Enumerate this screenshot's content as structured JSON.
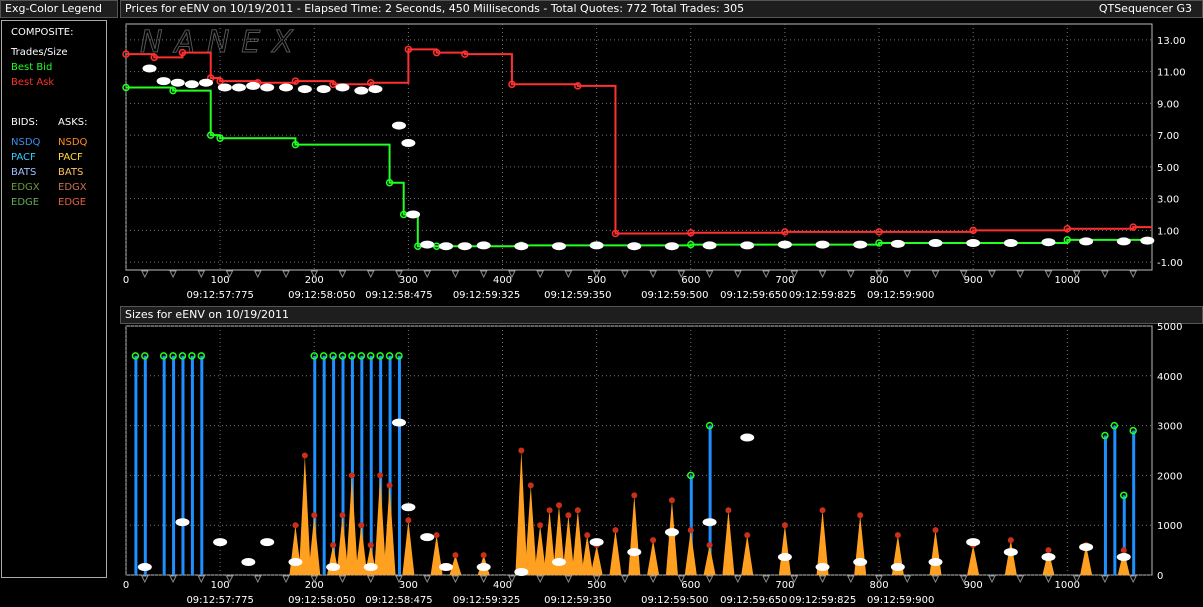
{
  "legend": {
    "title": "Exg-Color Legend",
    "composite_label": "COMPOSITE:",
    "trades_label": "Trades/Size",
    "best_bid_label": "Best Bid",
    "best_ask_label": "Best Ask",
    "bids_label": "BIDS:",
    "asks_label": "ASKS:",
    "exchanges": [
      {
        "bid": "NSDQ",
        "ask": "NSDQ",
        "bid_color": "#3b8eea",
        "ask_color": "#ff8c1a"
      },
      {
        "bid": "PACF",
        "ask": "PACF",
        "bid_color": "#33ccff",
        "ask_color": "#ffdd33"
      },
      {
        "bid": "BATS",
        "ask": "BATS",
        "bid_color": "#a0c0ff",
        "ask_color": "#ffc060"
      },
      {
        "bid": "EDGX",
        "ask": "EDGX",
        "bid_color": "#6a9a3a",
        "ask_color": "#c87050"
      },
      {
        "bid": "EDGE",
        "ask": "EDGE",
        "bid_color": "#66aa55",
        "ask_color": "#e06040"
      }
    ],
    "colors": {
      "trades": "#ffffff",
      "best_bid": "#22ff22",
      "best_ask": "#ff3030"
    }
  },
  "price_header": {
    "text": "Prices for  eENV  on  10/19/2011   -  Elapsed Time: 2 Seconds, 450 Milliseconds   -  Total Quotes: 772   Total Trades: 305",
    "app_title": "QTSequencer G3"
  },
  "sizes_header": {
    "text": "Sizes for  eENV  on  10/19/2011"
  },
  "watermark": "NANEX",
  "x_axis": {
    "ticks": [
      "0",
      "100",
      "200",
      "300",
      "400",
      "500",
      "600",
      "700",
      "800",
      "900",
      "1000"
    ],
    "time_labels": [
      {
        "seq": 100,
        "label": "09:12:57:775"
      },
      {
        "seq": 208,
        "label": "09:12:58:050"
      },
      {
        "seq": 290,
        "label": "09:12:58:475"
      },
      {
        "seq": 383,
        "label": "09:12:59:325"
      },
      {
        "seq": 480,
        "label": "09:12:59:350"
      },
      {
        "seq": 583,
        "label": "09:12:59:500"
      },
      {
        "seq": 667,
        "label": "09:12:59:650"
      },
      {
        "seq": 740,
        "label": "09:12:59:825"
      },
      {
        "seq": 823,
        "label": "09:12:59:900"
      }
    ]
  },
  "chart_data": [
    {
      "type": "line",
      "title": "Prices for  eENV  on  10/19/2011",
      "xlabel": "",
      "ylabel": "",
      "xlim": [
        0,
        1090
      ],
      "ylim": [
        -1.5,
        14
      ],
      "y_ticks": [
        "13.00",
        "11.00",
        "9.00",
        "7.00",
        "5.00",
        "3.00",
        "1.00",
        "-1.00"
      ],
      "series": [
        {
          "name": "Best Ask",
          "color": "#ff3030",
          "x": [
            0,
            30,
            30,
            60,
            60,
            90,
            90,
            100,
            100,
            140,
            140,
            180,
            180,
            220,
            220,
            260,
            260,
            300,
            300,
            330,
            330,
            360,
            360,
            410,
            410,
            480,
            480,
            520,
            520,
            600,
            600,
            700,
            700,
            800,
            800,
            900,
            900,
            1000,
            1000,
            1070,
            1070,
            1090
          ],
          "y": [
            12.1,
            12.1,
            11.9,
            11.9,
            12.2,
            12.2,
            10.6,
            10.6,
            10.4,
            10.4,
            10.3,
            10.3,
            10.4,
            10.4,
            10.2,
            10.2,
            10.3,
            10.3,
            12.4,
            12.4,
            12.2,
            12.2,
            12.1,
            12.1,
            10.2,
            10.2,
            10.1,
            10.1,
            0.8,
            0.8,
            0.85,
            0.85,
            0.9,
            0.9,
            0.9,
            0.9,
            1.0,
            1.0,
            1.1,
            1.1,
            1.2,
            1.2
          ]
        },
        {
          "name": "Best Bid",
          "color": "#22ff22",
          "x": [
            0,
            50,
            50,
            90,
            90,
            100,
            100,
            180,
            180,
            280,
            280,
            295,
            295,
            310,
            310,
            330,
            330,
            420,
            420,
            600,
            600,
            800,
            800,
            1000,
            1000,
            1090
          ],
          "y": [
            10.0,
            10.0,
            9.8,
            9.8,
            7.0,
            7.0,
            6.8,
            6.8,
            6.4,
            6.4,
            4.0,
            4.0,
            2.0,
            2.0,
            0.0,
            0.0,
            0.0,
            0.0,
            0.05,
            0.05,
            0.1,
            0.1,
            0.2,
            0.2,
            0.4,
            0.4
          ]
        },
        {
          "name": "Trades",
          "color": "#ffffff",
          "x": [
            25,
            40,
            55,
            70,
            85,
            105,
            120,
            135,
            150,
            170,
            190,
            210,
            230,
            250,
            265,
            290,
            300,
            305,
            320,
            340,
            360,
            380,
            420,
            460,
            500,
            540,
            580,
            620,
            660,
            700,
            740,
            780,
            820,
            860,
            900,
            940,
            980,
            1020,
            1060,
            1085
          ],
          "y": [
            11.2,
            10.4,
            10.3,
            10.2,
            10.3,
            10.0,
            10.0,
            10.1,
            10.0,
            10.0,
            9.9,
            9.9,
            10.0,
            9.8,
            9.9,
            7.6,
            6.5,
            2.0,
            0.1,
            0.0,
            0.0,
            0.05,
            0.0,
            0.0,
            0.05,
            0.0,
            0.0,
            0.05,
            0.05,
            0.1,
            0.1,
            0.1,
            0.15,
            0.2,
            0.2,
            0.2,
            0.25,
            0.3,
            0.3,
            0.35
          ]
        }
      ]
    },
    {
      "type": "bar",
      "title": "Sizes for  eENV  on  10/19/2011",
      "xlabel": "",
      "ylabel": "",
      "xlim": [
        0,
        1090
      ],
      "ylim": [
        0,
        5000
      ],
      "y_ticks": [
        "5000",
        "4000",
        "3000",
        "2000",
        "1000",
        "0"
      ],
      "series": [
        {
          "name": "NSDQ",
          "color": "#1e90ff",
          "x": [
            10,
            20,
            40,
            50,
            60,
            70,
            80,
            200,
            210,
            220,
            230,
            240,
            250,
            260,
            270,
            280,
            290,
            580,
            600,
            620,
            1040,
            1050,
            1060,
            1070
          ],
          "y": [
            4400,
            4400,
            4400,
            4400,
            4400,
            4400,
            4400,
            4400,
            4400,
            4400,
            4400,
            4400,
            4400,
            4400,
            4400,
            4400,
            4400,
            800,
            2000,
            3000,
            2800,
            3000,
            1600,
            2900
          ]
        },
        {
          "name": "NSDQ Ask",
          "color": "#ffa020",
          "x": [
            180,
            190,
            200,
            220,
            230,
            240,
            250,
            260,
            270,
            280,
            300,
            330,
            350,
            380,
            420,
            430,
            440,
            450,
            460,
            470,
            480,
            490,
            500,
            520,
            540,
            560,
            580,
            600,
            620,
            640,
            660,
            700,
            740,
            780,
            820,
            860,
            900,
            940,
            980,
            1020,
            1060
          ],
          "y": [
            1000,
            2400,
            1200,
            600,
            1200,
            2000,
            1000,
            600,
            2000,
            1800,
            1100,
            800,
            400,
            400,
            2500,
            1800,
            1000,
            1300,
            1400,
            1200,
            1300,
            800,
            600,
            900,
            1600,
            700,
            1500,
            900,
            600,
            1300,
            800,
            1000,
            1300,
            1200,
            800,
            900,
            600,
            700,
            500,
            600,
            500
          ]
        },
        {
          "name": "Trades",
          "color": "#ffffff",
          "x": [
            20,
            60,
            100,
            130,
            150,
            180,
            220,
            260,
            290,
            300,
            320,
            340,
            380,
            420,
            460,
            500,
            540,
            580,
            620,
            660,
            700,
            740,
            780,
            820,
            860,
            900,
            940,
            980,
            1020,
            1060
          ],
          "y": [
            100,
            1000,
            600,
            200,
            600,
            200,
            100,
            100,
            3000,
            1300,
            700,
            100,
            100,
            0,
            200,
            600,
            400,
            800,
            1000,
            2700,
            300,
            100,
            200,
            100,
            200,
            600,
            400,
            300,
            500,
            300
          ]
        }
      ]
    }
  ]
}
